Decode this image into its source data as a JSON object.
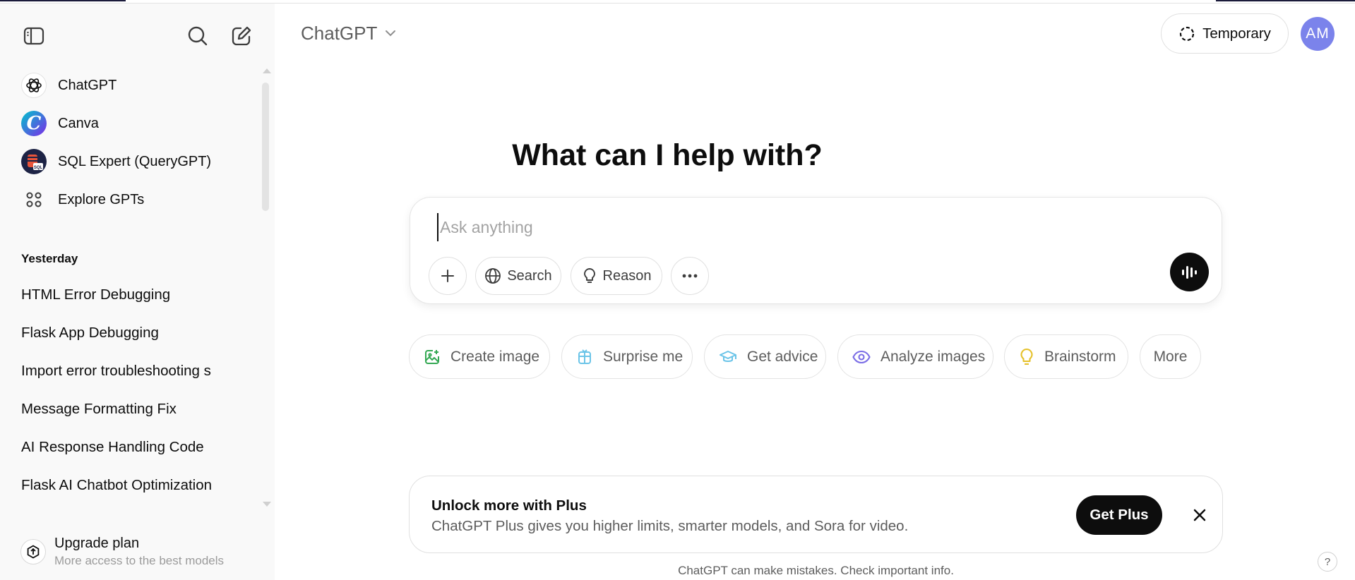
{
  "sidebar": {
    "gpts": [
      {
        "label": "ChatGPT",
        "icon": "chatgpt-logo-icon"
      },
      {
        "label": "Canva",
        "icon": "canva-logo-icon"
      },
      {
        "label": "SQL Expert (QueryGPT)",
        "icon": "sql-expert-logo-icon"
      },
      {
        "label": "Explore GPTs",
        "icon": "grid-icon"
      }
    ],
    "section_title": "Yesterday",
    "history": [
      "HTML Error Debugging",
      "Flask App Debugging",
      "Import error troubleshooting s",
      "Message Formatting Fix",
      "AI Response Handling Code",
      "Flask AI Chatbot Optimization"
    ],
    "upgrade": {
      "title": "Upgrade plan",
      "subtitle": "More access to the best models"
    }
  },
  "header": {
    "model": "ChatGPT",
    "temporary_label": "Temporary",
    "avatar_initials": "AM"
  },
  "main": {
    "hero": "What can I help with?",
    "composer": {
      "placeholder": "Ask anything",
      "search_label": "Search",
      "reason_label": "Reason"
    },
    "chips": [
      {
        "label": "Create image",
        "icon": "image-icon",
        "color": "#34a853"
      },
      {
        "label": "Surprise me",
        "icon": "gift-icon",
        "color": "#6bc4e8"
      },
      {
        "label": "Get advice",
        "icon": "graduation-cap-icon",
        "color": "#6bc4e8"
      },
      {
        "label": "Analyze images",
        "icon": "eye-icon",
        "color": "#7b6ee6"
      },
      {
        "label": "Brainstorm",
        "icon": "lightbulb-icon",
        "color": "#e5c12b"
      },
      {
        "label": "More"
      }
    ],
    "banner": {
      "title": "Unlock more with Plus",
      "subtitle": "ChatGPT Plus gives you higher limits, smarter models, and Sora for video.",
      "button": "Get Plus"
    },
    "footer": "ChatGPT can make mistakes. Check important info.",
    "help": "?"
  },
  "colors": {
    "accent": "#0d0d0d",
    "avatar": "#7b83eb",
    "sidebar_bg": "#f9f9f9"
  }
}
